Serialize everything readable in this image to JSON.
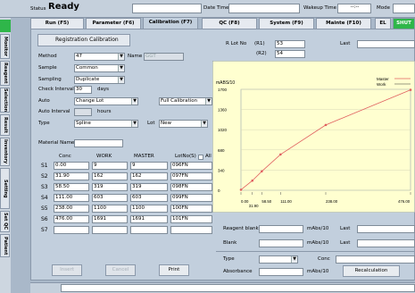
{
  "status": {
    "label": "Status",
    "value": "Ready",
    "datetime_label": "Date Time",
    "wakeup_label": "Wakeup Time",
    "wakeup_value": "--:--",
    "mode_label": "Mode"
  },
  "tabs": [
    "Run (F5)",
    "Parameter (F6)",
    "Calibration (F7)",
    "QC (F8)",
    "System (F9)",
    "Mainte (F10)",
    "EL",
    "SHUT"
  ],
  "side_tabs": [
    "Monitor",
    "Reagent",
    "Selection",
    "Result",
    "Inventory",
    "Setting Scheme",
    "Set QC",
    "Patient"
  ],
  "panel_title": "Registration Calibration",
  "form": {
    "method_label": "Method",
    "method_value": "47",
    "name_label": "Name",
    "name_value": "GGT",
    "sample_label": "Sample",
    "sample_value": "Common",
    "sampling_label": "Sampling",
    "sampling_value": "Duplicate",
    "check_label": "Check Interval",
    "check_value": "30",
    "check_unit": "days",
    "auto_label": "Auto",
    "auto_value": "Change Lot",
    "auto2_value": "Full Calibration",
    "auto_interval_label": "Auto Interval",
    "auto_interval_unit": "hours",
    "type_label": "Type",
    "type_value": "Spline",
    "lot_label": "Lot",
    "lot_value": "New",
    "material_label": "Material Name"
  },
  "table": {
    "headers": [
      "Conc",
      "WORK",
      "MASTER",
      "LotNo(S)",
      "All"
    ],
    "rows": [
      {
        "id": "S1",
        "conc": "0.00",
        "work": "9",
        "master": "9",
        "lot": "096FN"
      },
      {
        "id": "S2",
        "conc": "31.90",
        "work": "162",
        "master": "162",
        "lot": "097FN"
      },
      {
        "id": "S3",
        "conc": "58.50",
        "work": "319",
        "master": "319",
        "lot": "098FN"
      },
      {
        "id": "S4",
        "conc": "111.00",
        "work": "603",
        "master": "603",
        "lot": "099FN"
      },
      {
        "id": "S5",
        "conc": "238.00",
        "work": "1100",
        "master": "1100",
        "lot": "100FN"
      },
      {
        "id": "S6",
        "conc": "476.00",
        "work": "1691",
        "master": "1691",
        "lot": "101FN"
      },
      {
        "id": "S7",
        "conc": "",
        "work": "",
        "master": "",
        "lot": ""
      }
    ]
  },
  "buttons": {
    "insert": "Insert",
    "cancel": "Cancel",
    "print": "Print",
    "recalc": "Recalculation"
  },
  "rlot": {
    "label": "R Lot No",
    "r1": "(R1)",
    "r1_value": "53",
    "r2": "(R2)",
    "r2_value": "54",
    "last": "Last"
  },
  "chart_data": {
    "type": "line",
    "ylabel": "mABS/10",
    "yticks": [
      0,
      340,
      680,
      1020,
      1360,
      1700
    ],
    "ylim": [
      0,
      1700
    ],
    "xlim": [
      0,
      476
    ],
    "xtick_labels": [
      "0.00",
      "58.50",
      "111.00",
      "238.00",
      "476.00"
    ],
    "xtick_labels_low": [
      "31.90"
    ],
    "legend": [
      "Master",
      "Work"
    ],
    "series": [
      {
        "name": "Master",
        "x": [
          0,
          31.9,
          58.5,
          111,
          238,
          476
        ],
        "y": [
          9,
          162,
          319,
          603,
          1100,
          1691
        ]
      }
    ],
    "colors": {
      "line": "#e06060",
      "bg": "#ffffd0"
    }
  },
  "bottom": {
    "reagent_blank": "Reagent blank",
    "blank": "Blank",
    "unit": "mAbs/10",
    "last": "Last",
    "type_label": "Type",
    "conc_label": "Conc",
    "absorbance_label": "Absorbance",
    "abs_unit": "mAbs/10"
  }
}
